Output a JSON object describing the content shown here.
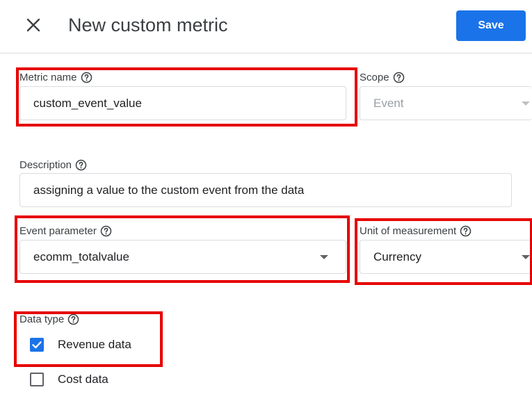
{
  "header": {
    "title": "New custom metric",
    "save_label": "Save"
  },
  "form": {
    "metric_name": {
      "label": "Metric name",
      "value": "custom_event_value"
    },
    "scope": {
      "label": "Scope",
      "value": "Event",
      "disabled": true
    },
    "description": {
      "label": "Description",
      "value": "assigning a value to the custom event from the data"
    },
    "event_parameter": {
      "label": "Event parameter",
      "value": "ecomm_totalvalue"
    },
    "unit_of_measurement": {
      "label": "Unit of measurement",
      "value": "Currency"
    },
    "data_type": {
      "label": "Data type",
      "options": [
        {
          "label": "Revenue data",
          "checked": true
        },
        {
          "label": "Cost data",
          "checked": false
        }
      ]
    }
  },
  "icons": {
    "close": "close-icon",
    "help": "help-circle-icon",
    "dropdown": "chevron-down-icon",
    "check": "check-icon"
  },
  "colors": {
    "accent": "#1a73e8",
    "highlight": "#e60000",
    "border": "#dadce0"
  }
}
